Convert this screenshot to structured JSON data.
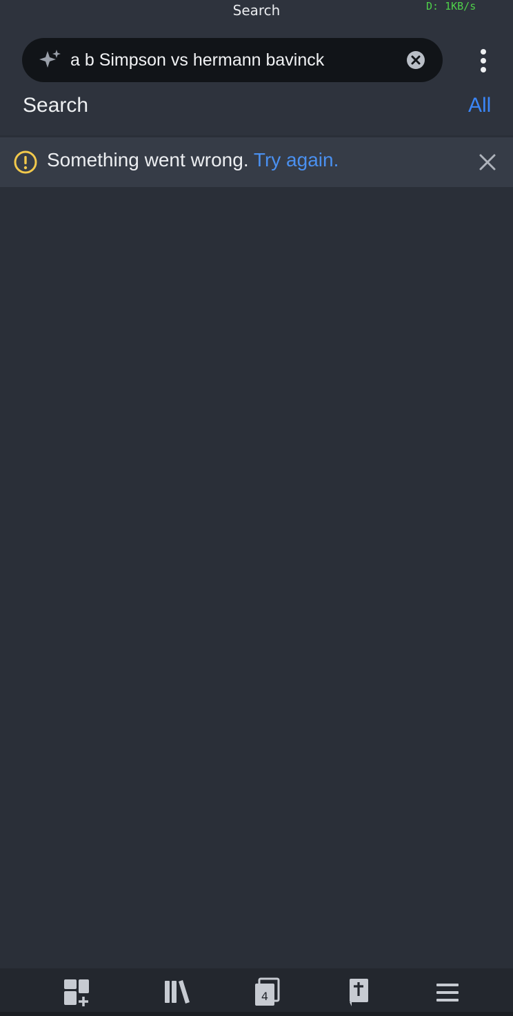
{
  "status_bar": {
    "net_speed": "D: 1KB/s"
  },
  "header": {
    "title": "Search",
    "search": {
      "value": "a b Simpson vs hermann bavinck",
      "placeholder": ""
    },
    "section_label": "Search",
    "filter_label": "All"
  },
  "error_banner": {
    "message": "Something went wrong.",
    "retry_label": "Try again."
  },
  "bottom_nav": {
    "tabs_count": "4"
  },
  "colors": {
    "background": "#2a2f38",
    "accent": "#3b86f7",
    "warning": "#f2c94c",
    "net_speed": "#4fd14a"
  },
  "icons": [
    "sparkle-icon",
    "clear-icon",
    "more-vertical-icon",
    "warning-icon",
    "close-icon",
    "dashboard-add-icon",
    "library-icon",
    "tabs-icon",
    "bible-icon",
    "menu-icon"
  ]
}
